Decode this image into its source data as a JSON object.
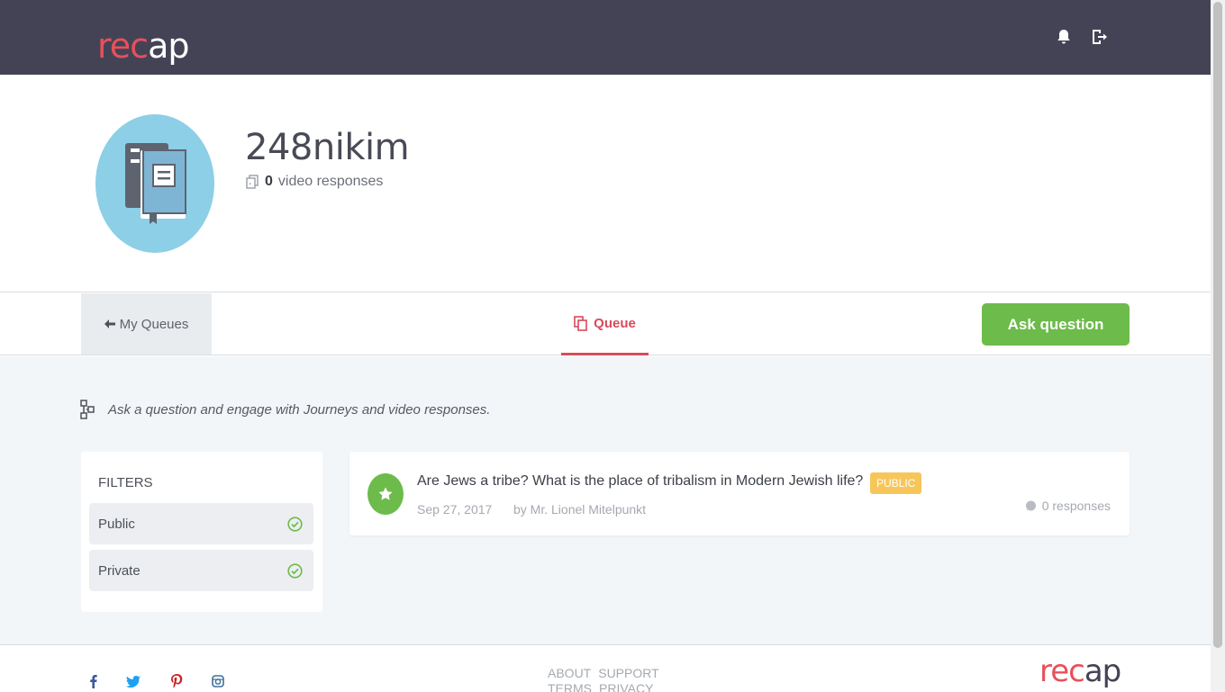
{
  "header": {
    "logo_text_main": "rec",
    "logo_text_accent": "ap",
    "icons": [
      "bell-icon",
      "logout-icon"
    ]
  },
  "profile": {
    "username": "248nikim",
    "video_responses_count": "0",
    "video_responses_label": "video responses"
  },
  "tabs": {
    "back_label": "My Queues",
    "queue_label": "Queue",
    "ask_button": "Ask question"
  },
  "main": {
    "hint": "Ask a question and engage with Journeys and video responses."
  },
  "filters": {
    "title": "FILTERS",
    "items": [
      {
        "label": "Public",
        "checked": true
      },
      {
        "label": "Private",
        "checked": true
      }
    ]
  },
  "question": {
    "title": "Are Jews a tribe? What is the place of tribalism in Modern Jewish life?",
    "badge": "PUBLIC",
    "date": "Sep 27, 2017",
    "author": "by Mr. Lionel Mitelpunkt",
    "responses": "0 responses"
  },
  "footer": {
    "links_row1": [
      "ABOUT",
      "SUPPORT"
    ],
    "links_row2": [
      "TERMS",
      "PRIVACY"
    ],
    "logo_text_main": "rec",
    "logo_text_accent": "ap",
    "social": [
      "facebook-icon",
      "twitter-icon",
      "pinterest-icon",
      "instagram-icon"
    ]
  },
  "colors": {
    "header_bg": "#444356",
    "brand_red": "#e8505b",
    "accent_green": "#6dbb4a",
    "badge_yellow": "#f7c65a",
    "tab_active": "#d94a5a",
    "avatar_bg": "#8ccfe6"
  }
}
